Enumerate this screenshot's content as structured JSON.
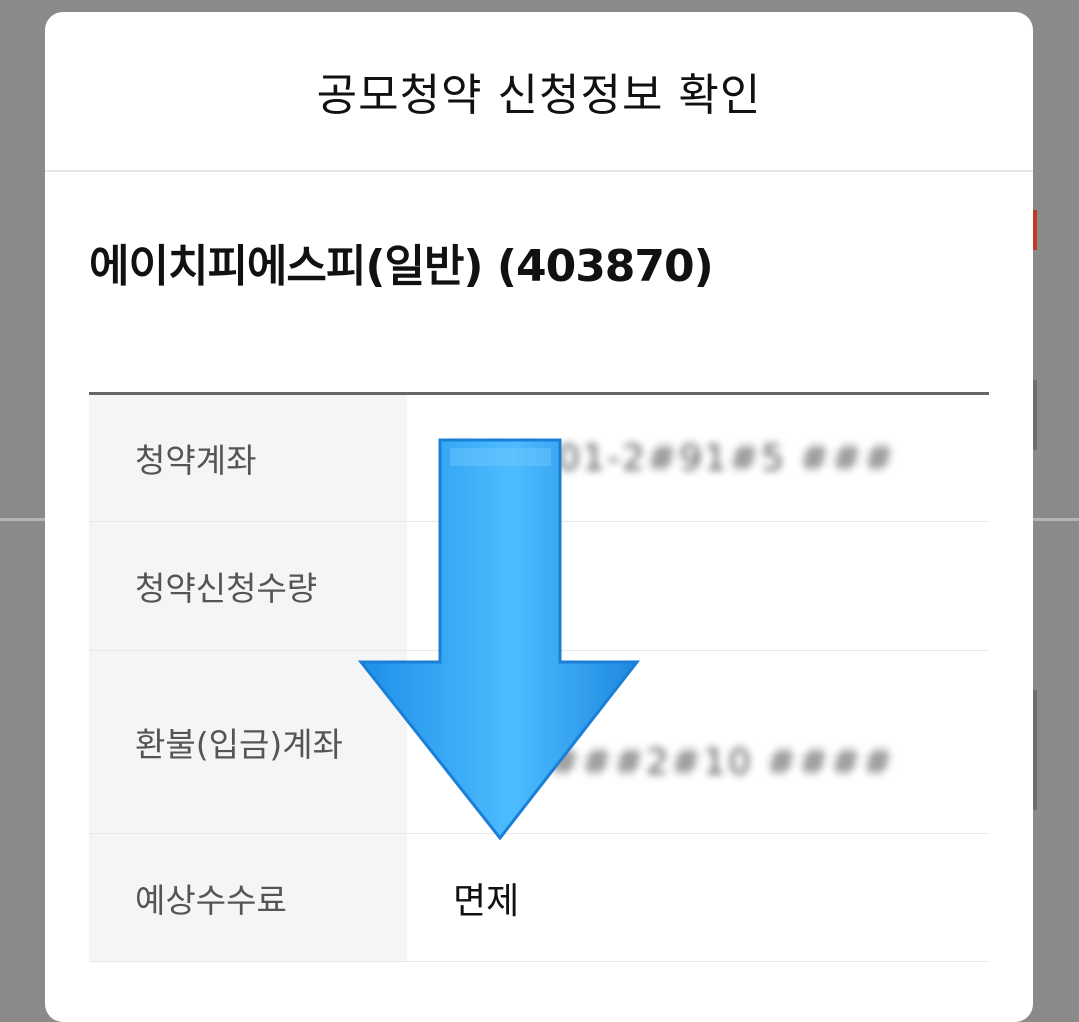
{
  "dialog": {
    "title": "공모청약 신청정보 확인",
    "stock_name": "에이치피에스피(일반) (403870)"
  },
  "rows": [
    {
      "label": "청약계좌",
      "value": "2##-01-2#91#5 ###"
    },
    {
      "label": "청약신청수량",
      "value": "1#"
    },
    {
      "label": "환불(입금)계좌",
      "value_line1": "##",
      "value_line2": "######2#10 #### "
    },
    {
      "label": "예상수수료",
      "value": "면제"
    }
  ],
  "colors": {
    "overlay": "#8a8a8a",
    "modal_bg": "#ffffff",
    "label_bg": "#f5f5f5",
    "arrow": "#2ba4f5"
  },
  "icons": {
    "overlay_arrow": "arrow-down-icon"
  }
}
